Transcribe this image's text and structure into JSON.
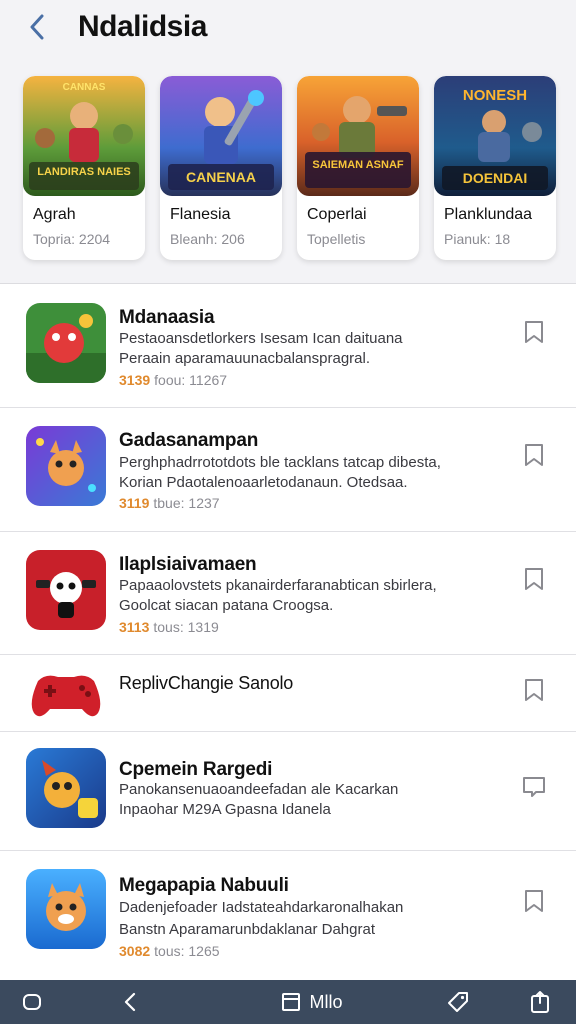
{
  "header": {
    "title": "Ndalidsia",
    "back_icon": "chevron-left-icon"
  },
  "featured": [
    {
      "name": "Agrah",
      "meta": "Topria: 2204",
      "banner": "LANDIRAS NAIES",
      "top_text": "CANNAS"
    },
    {
      "name": "Flanesia",
      "meta": "Bleanh: 206",
      "banner": "CANENAA",
      "top_text": ""
    },
    {
      "name": "Coperlai",
      "meta": "Topelletis",
      "banner": "SAIEMAN ASNAF",
      "top_text": ""
    },
    {
      "name": "Planklundaa",
      "meta": "Pianuk: 18",
      "banner": "DOENDAI",
      "top_text": "NONESH"
    }
  ],
  "apps": [
    {
      "title": "Mdanaasia",
      "desc": [
        "Pestaoansdetlorkers Isesam Ican daituana",
        "Peraain aparamauunacbalanspragral."
      ],
      "score": "3139",
      "meta": "foou: 11267"
    },
    {
      "title": "Gadasanampan",
      "desc": [
        "Perghphadrrototdots ble tacklans tatcap dibesta,",
        "Korian Pdaotalenoaarletodanaun. Otedsaa."
      ],
      "score": "3119",
      "meta": "tbue: 1237"
    },
    {
      "title": "Ilaplsiaivamaen",
      "desc": [
        "Papaaolovstets pkanairderfaranabtican sbirlera,",
        "Goolcat siacan patana Croogsa."
      ],
      "score": "3113",
      "meta": "tous: 1319"
    },
    {
      "title": "ReplivChangie Sanolo",
      "desc": [],
      "score": "",
      "meta": ""
    },
    {
      "title": "Cpemein Rargedi",
      "desc": [
        "Panokansenuaoandeefadan ale Kacarkan",
        "Inpaohar M29A Gpasna Idanela"
      ],
      "score": "",
      "meta": ""
    },
    {
      "title": "Megapapia Nabuuli",
      "desc": [
        "Dadenjefoader Iadstateahdarkaronalhakan",
        "Banstn Aparamarunbdaklanar Dahgrat"
      ],
      "score": "3082",
      "meta": "tous: 1265"
    }
  ],
  "bottom_nav": {
    "center_label": "Mllo"
  },
  "colors": {
    "accent": "#3b4a5e",
    "score": "#e08a2e",
    "background": "#f3f3f6"
  }
}
